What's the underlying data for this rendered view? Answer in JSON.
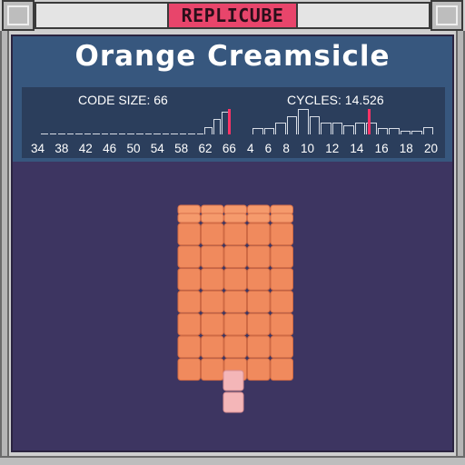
{
  "app": {
    "title": "REPLICUBE"
  },
  "puzzle": {
    "name": "Orange Creamsicle"
  },
  "stats": {
    "code_size_label": "CODE SIZE: 66",
    "cycles_label": "CYCLES: 14.526",
    "code_size": {
      "value": 66,
      "ticks": [
        "34",
        "38",
        "42",
        "46",
        "50",
        "54",
        "58",
        "62",
        "66"
      ],
      "histogram": [
        0,
        0,
        0,
        0,
        0,
        0,
        0,
        0,
        0,
        0,
        0,
        0,
        0,
        0,
        0,
        0,
        0,
        0,
        0.05,
        0.3,
        0.6,
        0.9
      ]
    },
    "cycles": {
      "value": 14.526,
      "ticks": [
        "4",
        "6",
        "8",
        "10",
        "12",
        "14",
        "16",
        "18",
        "20"
      ],
      "histogram": [
        0.25,
        0.25,
        0.45,
        0.7,
        1.0,
        0.7,
        0.45,
        0.45,
        0.35,
        0.45,
        0.45,
        0.25,
        0.25,
        0.15,
        0.15,
        0.3
      ]
    }
  },
  "colors": {
    "accent": "#e8456b",
    "header_bg": "#37577e",
    "stats_bg": "#2b3e5c",
    "viewport_bg": "#3d3561",
    "cube_orange": "#f08a5d",
    "cube_pink": "#f4b6b8",
    "marker": "#ff3366"
  }
}
